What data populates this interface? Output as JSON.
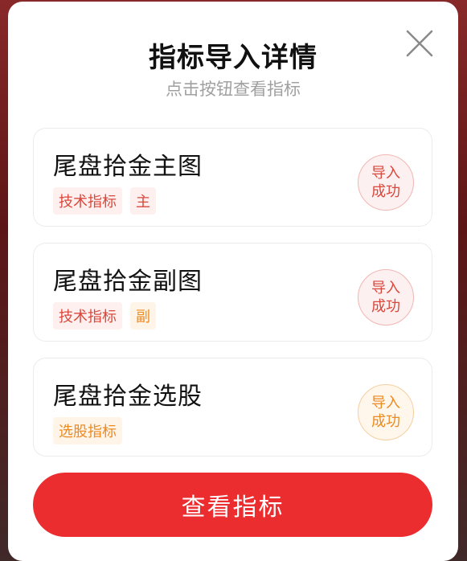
{
  "dialog": {
    "title": "指标导入详情",
    "subtitle": "点击按钮查看指标"
  },
  "indicators": [
    {
      "name": "尾盘拾金主图",
      "tags": [
        {
          "label": "技术指标",
          "color": "red"
        },
        {
          "label": "主",
          "color": "red"
        }
      ],
      "status_line1": "导入",
      "status_line2": "成功",
      "status_color": "red"
    },
    {
      "name": "尾盘拾金副图",
      "tags": [
        {
          "label": "技术指标",
          "color": "red"
        },
        {
          "label": "副",
          "color": "orange"
        }
      ],
      "status_line1": "导入",
      "status_line2": "成功",
      "status_color": "red"
    },
    {
      "name": "尾盘拾金选股",
      "tags": [
        {
          "label": "选股指标",
          "color": "orange"
        }
      ],
      "status_line1": "导入",
      "status_line2": "成功",
      "status_color": "orange"
    }
  ],
  "primary_button": {
    "label": "查看指标"
  },
  "colors": {
    "accent_red": "#eb2d30",
    "tag_red": "#d9483c",
    "tag_orange": "#ec8b22"
  },
  "icons": {
    "close": "close-icon"
  }
}
